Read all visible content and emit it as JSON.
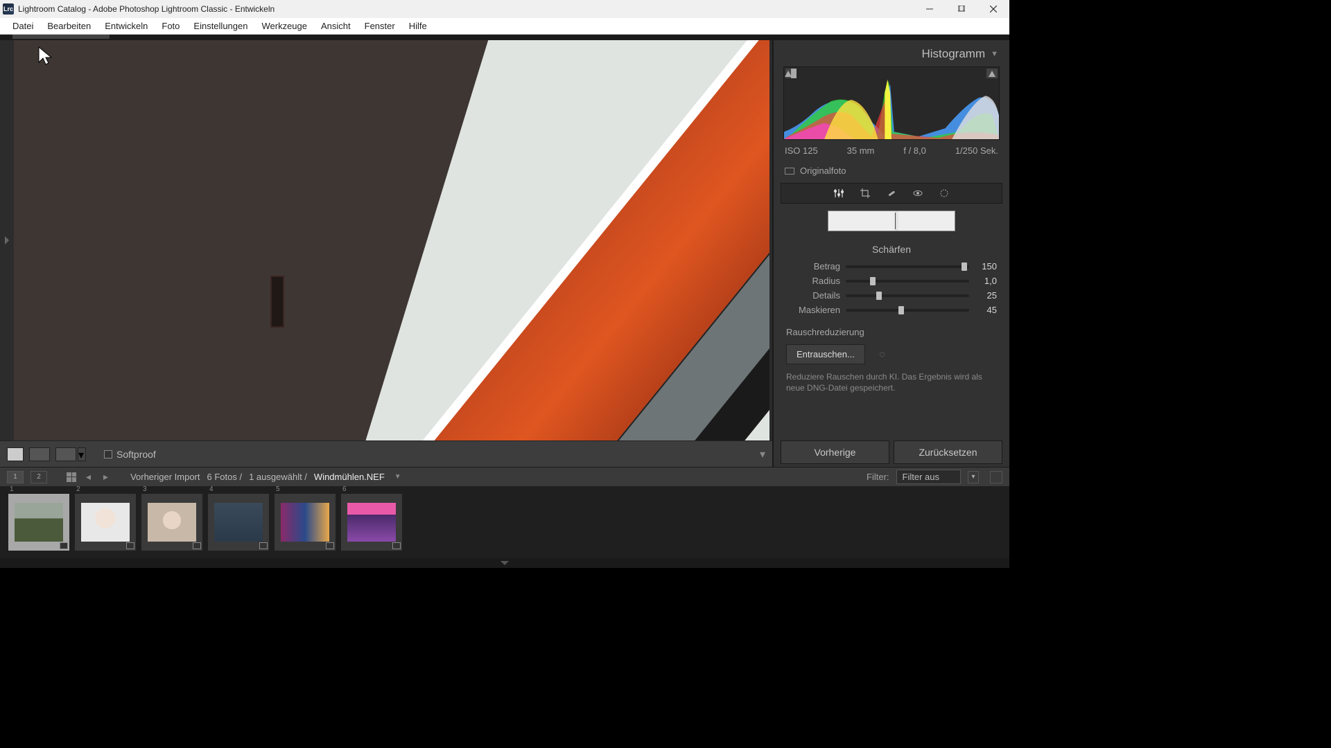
{
  "window": {
    "title": "Lightroom Catalog - Adobe Photoshop Lightroom Classic - Entwickeln",
    "icon_label": "Lrc"
  },
  "menu": {
    "items": [
      "Datei",
      "Bearbeiten",
      "Entwickeln",
      "Foto",
      "Einstellungen",
      "Werkzeuge",
      "Ansicht",
      "Fenster",
      "Hilfe"
    ]
  },
  "canvas_toolbar": {
    "softproof": "Softproof"
  },
  "right_panel": {
    "histogram_title": "Histogramm",
    "exif": {
      "iso": "ISO 125",
      "focal": "35 mm",
      "aperture": "f / 8,0",
      "shutter": "1/250 Sek."
    },
    "original": "Originalfoto",
    "sharpen": {
      "title": "Schärfen",
      "sliders": [
        {
          "label": "Betrag",
          "value": "150",
          "pos": 96
        },
        {
          "label": "Radius",
          "value": "1,0",
          "pos": 22
        },
        {
          "label": "Details",
          "value": "25",
          "pos": 27
        },
        {
          "label": "Maskieren",
          "value": "45",
          "pos": 45
        }
      ]
    },
    "noise": {
      "title": "Rauschreduzierung",
      "button": "Entrauschen...",
      "help": "Reduziere Rauschen durch KI. Das Ergebnis wird als neue DNG-Datei gespeichert."
    },
    "buttons": {
      "prev": "Vorherige",
      "reset": "Zurücksetzen"
    }
  },
  "filmstrip_header": {
    "main_num": "1",
    "second_num": "2",
    "path": {
      "prev_import": "Vorheriger Import",
      "count": "6 Fotos /",
      "selected": "1 ausgewählt /",
      "filename": "Windmühlen.NEF"
    },
    "filter_label": "Filter:",
    "filter_value": "Filter aus"
  },
  "thumbnails": [
    {
      "n": "1",
      "cls": "windmill",
      "sel": true
    },
    {
      "n": "2",
      "cls": "baby1",
      "sel": false
    },
    {
      "n": "3",
      "cls": "baby2",
      "sel": false
    },
    {
      "n": "4",
      "cls": "desk",
      "sel": false
    },
    {
      "n": "5",
      "cls": "neon",
      "sel": false
    },
    {
      "n": "6",
      "cls": "sunset",
      "sel": false
    }
  ]
}
